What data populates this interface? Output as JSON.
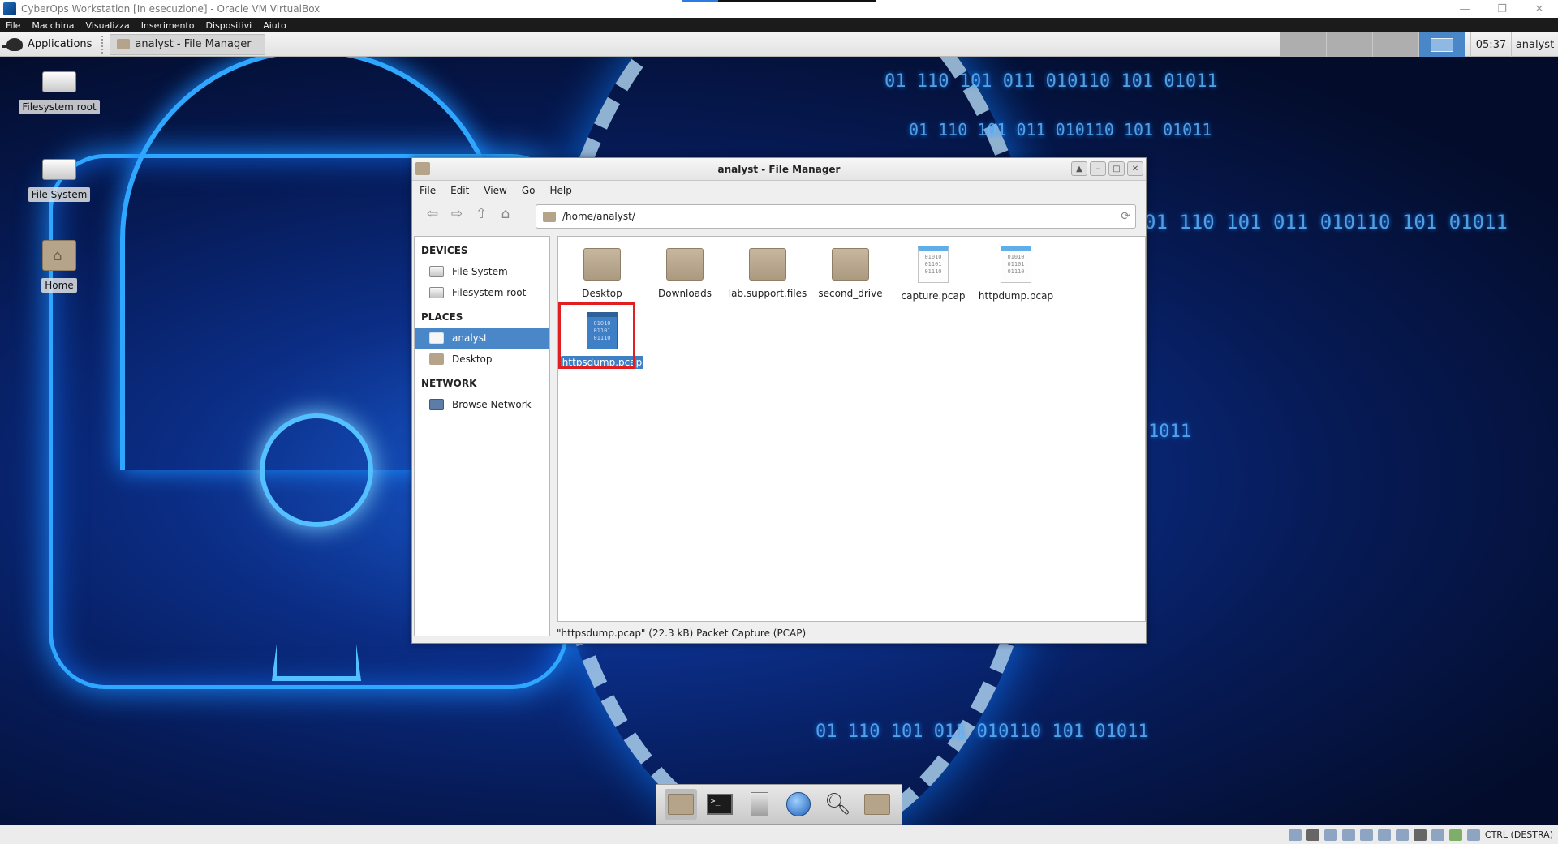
{
  "host": {
    "window_title": "CyberOps Workstation [In esecuzione] - Oracle VM VirtualBox",
    "window_buttons": [
      "—",
      "❐",
      "✕"
    ],
    "menu": [
      "File",
      "Macchina",
      "Visualizza",
      "Inserimento",
      "Dispositivi",
      "Aiuto"
    ],
    "status_right_key": "CTRL (DESTRA)"
  },
  "panel": {
    "applications_label": "Applications",
    "task_title": "analyst - File Manager",
    "clock": "05:37",
    "user": "analyst"
  },
  "desktop_icons": [
    {
      "label": "Filesystem root"
    },
    {
      "label": "File System"
    },
    {
      "label": "Home"
    }
  ],
  "wallpaper_text": [
    "01 110 101 011 010110 101 01011",
    "01 110 101 011 010110 101 01011",
    "01 110 101 011 010110 101 01011",
    "1011",
    "01 110 101 011 010110 101 01011"
  ],
  "file_manager": {
    "title": "analyst - File Manager",
    "menu": [
      "File",
      "Edit",
      "View",
      "Go",
      "Help"
    ],
    "path": "/home/analyst/",
    "sidebar": {
      "devices_header": "DEVICES",
      "devices": [
        "File System",
        "Filesystem root"
      ],
      "places_header": "PLACES",
      "places": [
        "analyst",
        "Desktop"
      ],
      "network_header": "NETWORK",
      "network": [
        "Browse Network"
      ]
    },
    "files": [
      {
        "name": "Desktop",
        "type": "folder"
      },
      {
        "name": "Downloads",
        "type": "folder"
      },
      {
        "name": "lab.support.files",
        "type": "folder"
      },
      {
        "name": "second_drive",
        "type": "folder"
      },
      {
        "name": "capture.pcap",
        "type": "pcap"
      },
      {
        "name": "httpdump.pcap",
        "type": "pcap"
      },
      {
        "name": "httpsdump.pcap",
        "type": "pcap",
        "selected": true
      }
    ],
    "doc_icon_text": "01010\n01101\n01110",
    "status": "\"httpsdump.pcap\" (22.3 kB) Packet Capture (PCAP)"
  },
  "dock": {
    "terminal_text": ">_"
  }
}
